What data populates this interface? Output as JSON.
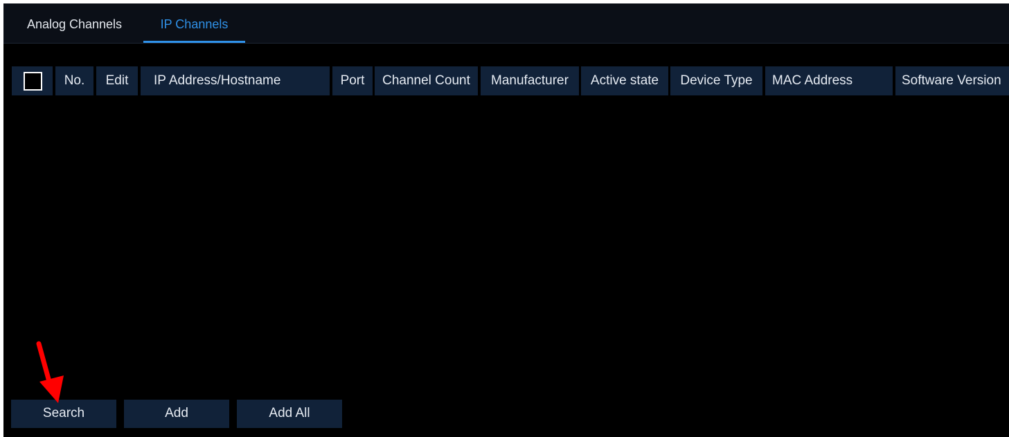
{
  "tabs": [
    {
      "label": "Analog Channels",
      "active": false
    },
    {
      "label": "IP Channels",
      "active": true
    }
  ],
  "table": {
    "columns": [
      "",
      "No.",
      "Edit",
      "IP Address/Hostname",
      "Port",
      "Channel Count",
      "Manufacturer",
      "Active state",
      "Device Type",
      "MAC Address",
      "Software Version"
    ],
    "rows": []
  },
  "buttons": {
    "search": "Search",
    "add": "Add",
    "add_all": "Add All"
  },
  "colors": {
    "active_tab": "#2f91e8",
    "header_bg": "#112239",
    "button_bg": "#112239",
    "annotation_arrow": "#ff0000"
  },
  "annotation": {
    "icon": "red-arrow-icon",
    "points_to": "search-button"
  }
}
